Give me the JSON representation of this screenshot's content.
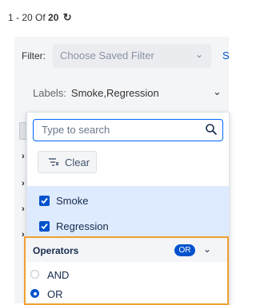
{
  "pagination": {
    "range": "1 - 20",
    "of_label": "Of",
    "total": "20",
    "refresh_icon": "refresh-icon"
  },
  "filter": {
    "label": "Filter:",
    "placeholder": "Choose Saved Filter",
    "link_stub": "S"
  },
  "labels": {
    "label": "Labels:",
    "value": "Smoke,Regression"
  },
  "dropdown": {
    "search_placeholder": "Type to search",
    "clear_label": "Clear",
    "options": [
      {
        "label": "Smoke",
        "checked": true
      },
      {
        "label": "Regression",
        "checked": true
      }
    ],
    "operators": {
      "title": "Operators",
      "badge": "OR",
      "choices": [
        {
          "label": "AND",
          "selected": false
        },
        {
          "label": "OR",
          "selected": true
        }
      ]
    }
  },
  "colors": {
    "accent": "#0052cc",
    "highlight_border": "#f0a030",
    "option_bg": "#deebff"
  }
}
